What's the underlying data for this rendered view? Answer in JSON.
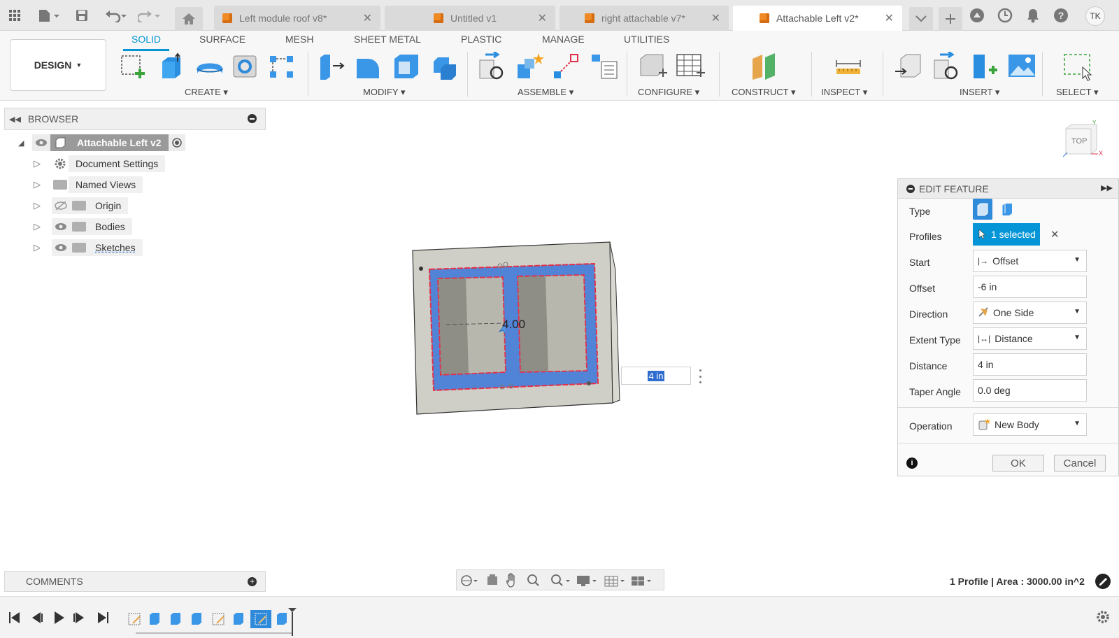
{
  "tabs": [
    {
      "label": "Left module roof v8*"
    },
    {
      "label": "Untitled v1"
    },
    {
      "label": "right attachable v7*"
    },
    {
      "label": "Attachable Left v2*"
    }
  ],
  "user_initials": "TK",
  "ribbon": {
    "workspace": "DESIGN",
    "tabs": [
      "SOLID",
      "SURFACE",
      "MESH",
      "SHEET METAL",
      "PLASTIC",
      "MANAGE",
      "UTILITIES"
    ],
    "groups": [
      "CREATE",
      "MODIFY",
      "ASSEMBLE",
      "CONFIGURE",
      "CONSTRUCT",
      "INSPECT",
      "INSERT",
      "SELECT"
    ]
  },
  "browser": {
    "title": "BROWSER",
    "root": "Attachable Left v2",
    "items": [
      "Document Settings",
      "Named Views",
      "Origin",
      "Bodies",
      "Sketches"
    ]
  },
  "viewport": {
    "viewcube_label": "TOP",
    "dimension_label": "4.00",
    "distance_input": "4 in"
  },
  "edit_feature": {
    "title": "EDIT FEATURE",
    "labels": {
      "type": "Type",
      "profiles": "Profiles",
      "start": "Start",
      "offset": "Offset",
      "direction": "Direction",
      "extent_type": "Extent Type",
      "distance": "Distance",
      "taper_angle": "Taper Angle",
      "operation": "Operation"
    },
    "profiles_value": "1 selected",
    "start_value": "Offset",
    "offset_value": "-6 in",
    "direction_value": "One Side",
    "extent_type_value": "Distance",
    "distance_value": "4 in",
    "taper_angle_value": "0.0 deg",
    "operation_value": "New Body",
    "ok_label": "OK",
    "cancel_label": "Cancel"
  },
  "comments_title": "COMMENTS",
  "status_text": "1 Profile | Area : 3000.00 in^2",
  "colors": {
    "accent": "#0696d7",
    "profile_blue": "#4a7fd8",
    "sketch_red": "#e3304a",
    "body_gray": "#cfcfc7"
  }
}
